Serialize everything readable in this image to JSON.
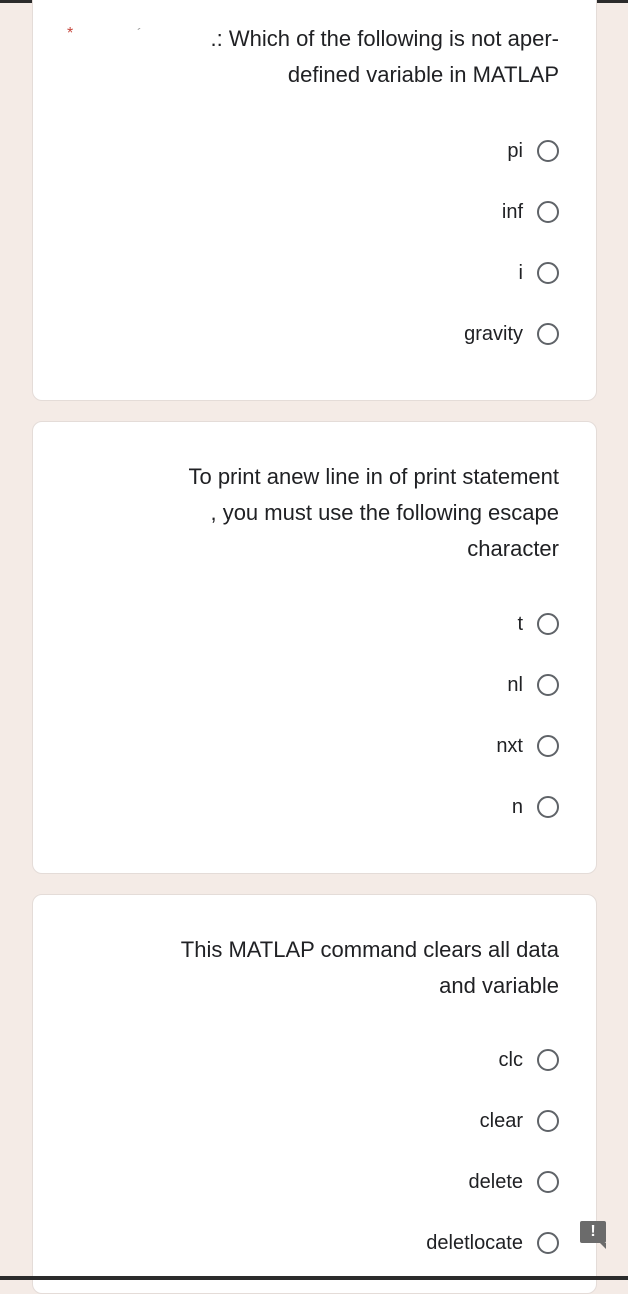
{
  "questions": [
    {
      "required_mark": "*",
      "prefix_mark": "´",
      "title_line1": ".: Which of the following is not aper-",
      "title_line2": "defined variable in MATLAP",
      "options": [
        "pi",
        "inf",
        "i",
        "gravity"
      ]
    },
    {
      "title_line1": "To print anew line in of print statement",
      "title_line2": ", you must use the following escape",
      "title_line3": "character",
      "options": [
        "t",
        "nl",
        "nxt",
        "n"
      ]
    },
    {
      "title_line1": "This MATLAP command clears all data",
      "title_line2": "and variable",
      "options": [
        "clc",
        "clear",
        "delete",
        "deletlocate"
      ]
    }
  ],
  "feedback_button": {
    "icon": "!",
    "semantic": "feedback-icon"
  },
  "colors": {
    "background": "#f4ebe6",
    "card": "#ffffff",
    "required": "#c5443a",
    "radio": "#5f6368"
  }
}
